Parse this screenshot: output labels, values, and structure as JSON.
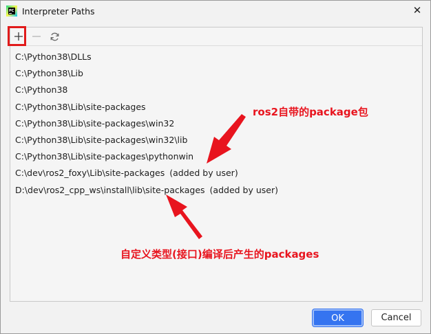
{
  "window": {
    "title": "Interpreter Paths",
    "close_glyph": "✕",
    "app_icon_text": "PC"
  },
  "toolbar": {
    "add": "+",
    "remove": "−",
    "refresh_icon": "refresh-icon"
  },
  "paths": [
    {
      "path": "C:\\Python38\\DLLs",
      "note": ""
    },
    {
      "path": "C:\\Python38\\Lib",
      "note": ""
    },
    {
      "path": "C:\\Python38",
      "note": ""
    },
    {
      "path": "C:\\Python38\\Lib\\site-packages",
      "note": ""
    },
    {
      "path": "C:\\Python38\\Lib\\site-packages\\win32",
      "note": ""
    },
    {
      "path": "C:\\Python38\\Lib\\site-packages\\win32\\lib",
      "note": ""
    },
    {
      "path": "C:\\Python38\\Lib\\site-packages\\pythonwin",
      "note": ""
    },
    {
      "path": "C:\\dev\\ros2_foxy\\Lib\\site-packages",
      "note": "(added by user)"
    },
    {
      "path": "D:\\dev\\ros2_cpp_ws\\install\\lib\\site-packages",
      "note": "(added by user)"
    }
  ],
  "annotations": {
    "builtin": "ros2自带的package包",
    "custom": "自定义类型(接口)编译后产生的packages",
    "color": "#e8141e"
  },
  "buttons": {
    "ok": "OK",
    "cancel": "Cancel"
  },
  "colors": {
    "accent": "#3574f0",
    "highlight_box": "#e11a1a"
  }
}
